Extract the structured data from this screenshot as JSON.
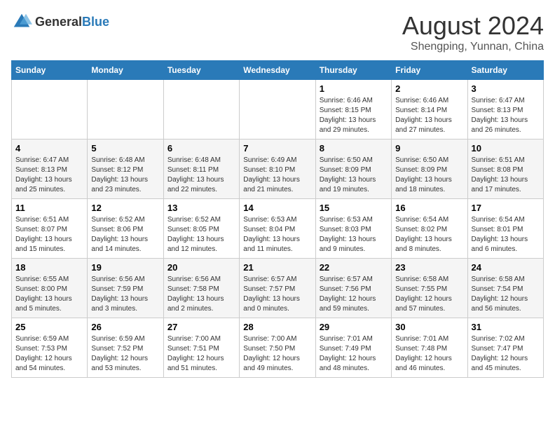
{
  "header": {
    "logo_general": "General",
    "logo_blue": "Blue",
    "title": "August 2024",
    "subtitle": "Shengping, Yunnan, China"
  },
  "days_of_week": [
    "Sunday",
    "Monday",
    "Tuesday",
    "Wednesday",
    "Thursday",
    "Friday",
    "Saturday"
  ],
  "weeks": [
    [
      {
        "day": "",
        "detail": ""
      },
      {
        "day": "",
        "detail": ""
      },
      {
        "day": "",
        "detail": ""
      },
      {
        "day": "",
        "detail": ""
      },
      {
        "day": "1",
        "detail": "Sunrise: 6:46 AM\nSunset: 8:15 PM\nDaylight: 13 hours\nand 29 minutes."
      },
      {
        "day": "2",
        "detail": "Sunrise: 6:46 AM\nSunset: 8:14 PM\nDaylight: 13 hours\nand 27 minutes."
      },
      {
        "day": "3",
        "detail": "Sunrise: 6:47 AM\nSunset: 8:13 PM\nDaylight: 13 hours\nand 26 minutes."
      }
    ],
    [
      {
        "day": "4",
        "detail": "Sunrise: 6:47 AM\nSunset: 8:13 PM\nDaylight: 13 hours\nand 25 minutes."
      },
      {
        "day": "5",
        "detail": "Sunrise: 6:48 AM\nSunset: 8:12 PM\nDaylight: 13 hours\nand 23 minutes."
      },
      {
        "day": "6",
        "detail": "Sunrise: 6:48 AM\nSunset: 8:11 PM\nDaylight: 13 hours\nand 22 minutes."
      },
      {
        "day": "7",
        "detail": "Sunrise: 6:49 AM\nSunset: 8:10 PM\nDaylight: 13 hours\nand 21 minutes."
      },
      {
        "day": "8",
        "detail": "Sunrise: 6:50 AM\nSunset: 8:09 PM\nDaylight: 13 hours\nand 19 minutes."
      },
      {
        "day": "9",
        "detail": "Sunrise: 6:50 AM\nSunset: 8:09 PM\nDaylight: 13 hours\nand 18 minutes."
      },
      {
        "day": "10",
        "detail": "Sunrise: 6:51 AM\nSunset: 8:08 PM\nDaylight: 13 hours\nand 17 minutes."
      }
    ],
    [
      {
        "day": "11",
        "detail": "Sunrise: 6:51 AM\nSunset: 8:07 PM\nDaylight: 13 hours\nand 15 minutes."
      },
      {
        "day": "12",
        "detail": "Sunrise: 6:52 AM\nSunset: 8:06 PM\nDaylight: 13 hours\nand 14 minutes."
      },
      {
        "day": "13",
        "detail": "Sunrise: 6:52 AM\nSunset: 8:05 PM\nDaylight: 13 hours\nand 12 minutes."
      },
      {
        "day": "14",
        "detail": "Sunrise: 6:53 AM\nSunset: 8:04 PM\nDaylight: 13 hours\nand 11 minutes."
      },
      {
        "day": "15",
        "detail": "Sunrise: 6:53 AM\nSunset: 8:03 PM\nDaylight: 13 hours\nand 9 minutes."
      },
      {
        "day": "16",
        "detail": "Sunrise: 6:54 AM\nSunset: 8:02 PM\nDaylight: 13 hours\nand 8 minutes."
      },
      {
        "day": "17",
        "detail": "Sunrise: 6:54 AM\nSunset: 8:01 PM\nDaylight: 13 hours\nand 6 minutes."
      }
    ],
    [
      {
        "day": "18",
        "detail": "Sunrise: 6:55 AM\nSunset: 8:00 PM\nDaylight: 13 hours\nand 5 minutes."
      },
      {
        "day": "19",
        "detail": "Sunrise: 6:56 AM\nSunset: 7:59 PM\nDaylight: 13 hours\nand 3 minutes."
      },
      {
        "day": "20",
        "detail": "Sunrise: 6:56 AM\nSunset: 7:58 PM\nDaylight: 13 hours\nand 2 minutes."
      },
      {
        "day": "21",
        "detail": "Sunrise: 6:57 AM\nSunset: 7:57 PM\nDaylight: 13 hours\nand 0 minutes."
      },
      {
        "day": "22",
        "detail": "Sunrise: 6:57 AM\nSunset: 7:56 PM\nDaylight: 12 hours\nand 59 minutes."
      },
      {
        "day": "23",
        "detail": "Sunrise: 6:58 AM\nSunset: 7:55 PM\nDaylight: 12 hours\nand 57 minutes."
      },
      {
        "day": "24",
        "detail": "Sunrise: 6:58 AM\nSunset: 7:54 PM\nDaylight: 12 hours\nand 56 minutes."
      }
    ],
    [
      {
        "day": "25",
        "detail": "Sunrise: 6:59 AM\nSunset: 7:53 PM\nDaylight: 12 hours\nand 54 minutes."
      },
      {
        "day": "26",
        "detail": "Sunrise: 6:59 AM\nSunset: 7:52 PM\nDaylight: 12 hours\nand 53 minutes."
      },
      {
        "day": "27",
        "detail": "Sunrise: 7:00 AM\nSunset: 7:51 PM\nDaylight: 12 hours\nand 51 minutes."
      },
      {
        "day": "28",
        "detail": "Sunrise: 7:00 AM\nSunset: 7:50 PM\nDaylight: 12 hours\nand 49 minutes."
      },
      {
        "day": "29",
        "detail": "Sunrise: 7:01 AM\nSunset: 7:49 PM\nDaylight: 12 hours\nand 48 minutes."
      },
      {
        "day": "30",
        "detail": "Sunrise: 7:01 AM\nSunset: 7:48 PM\nDaylight: 12 hours\nand 46 minutes."
      },
      {
        "day": "31",
        "detail": "Sunrise: 7:02 AM\nSunset: 7:47 PM\nDaylight: 12 hours\nand 45 minutes."
      }
    ]
  ]
}
